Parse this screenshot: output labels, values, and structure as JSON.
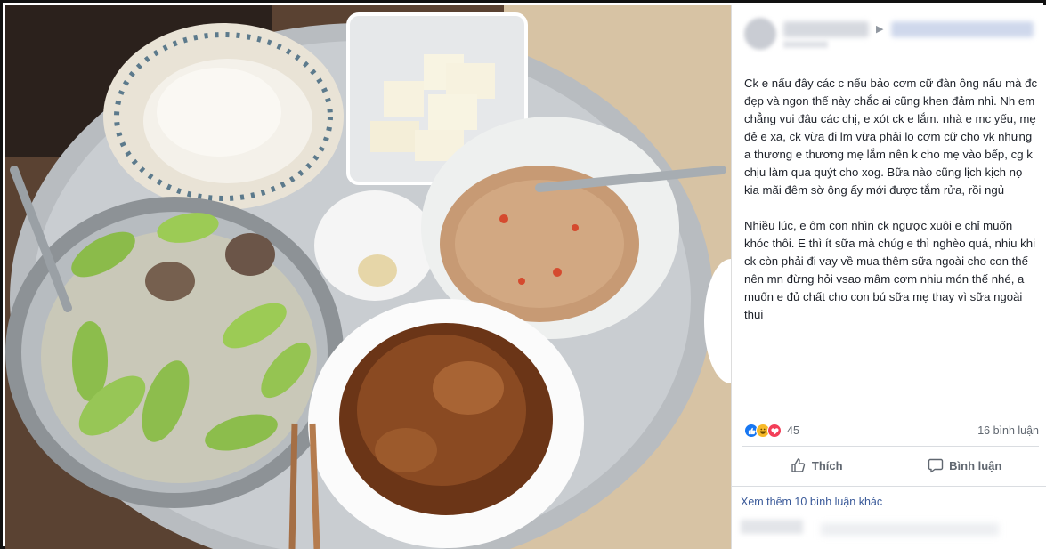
{
  "post": {
    "paragraph1": "Ck e nấu đây các c nếu bảo cơm cữ đàn ông nấu mà đc đẹp và ngon thế này chắc ai cũng khen đảm nhỉ. Nh em chẳng vui đâu các chị, e xót ck e lắm. nhà e mc yếu, mẹ đẻ e xa, ck vừa đi lm vừa phải lo cơm cữ cho vk nhưng a thương e thương mẹ lắm nên k cho mẹ vào bếp, cg k chịu làm qua quýt cho xog. Bữa nào cũng lịch kịch nọ kia mãi đêm sờ ông ấy mới được tắm rửa, rồi ngủ",
    "paragraph2": "Nhiều lúc, e ôm con nhìn ck ngược xuôi e chỉ muốn khóc thôi. E thì ít sữa mà chúg e thì nghèo quá, nhiu khi ck còn phải đi vay về mua thêm sữa ngoài cho con thế nên mn đừng hỏi vsao mâm cơm nhiu món thế nhé, a muốn e đủ chất cho con bú sữa mẹ thay vì sữa ngoài thui"
  },
  "reactions": {
    "icons": [
      "like-icon",
      "haha-icon",
      "love-icon"
    ],
    "count": "45",
    "comments": "16 bình luận"
  },
  "actions": {
    "like_label": "Thích",
    "comment_label": "Bình luận"
  },
  "more_comments": "Xem thêm 10 bình luận khác",
  "colors": {
    "link": "#385898",
    "like_blue": "#1877f2",
    "love_red": "#f33e58",
    "haha_yellow": "#f7b928",
    "text": "#1d2129",
    "muted": "#606770"
  }
}
